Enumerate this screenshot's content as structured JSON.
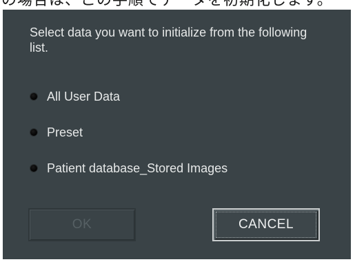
{
  "top_caption": "の場合は、この手順でデータを初期化します。",
  "dialog": {
    "instruction": "Select data you want to initialize from the following list.",
    "options": [
      {
        "label": "All User Data"
      },
      {
        "label": "Preset"
      },
      {
        "label": "Patient database_Stored Images"
      }
    ],
    "buttons": {
      "ok_label": "OK",
      "ok_enabled": false,
      "cancel_label": "CANCEL"
    }
  },
  "colors": {
    "dialog_background": "#3a4347",
    "text": "#e6e8e8",
    "disabled_text": "#566064"
  }
}
